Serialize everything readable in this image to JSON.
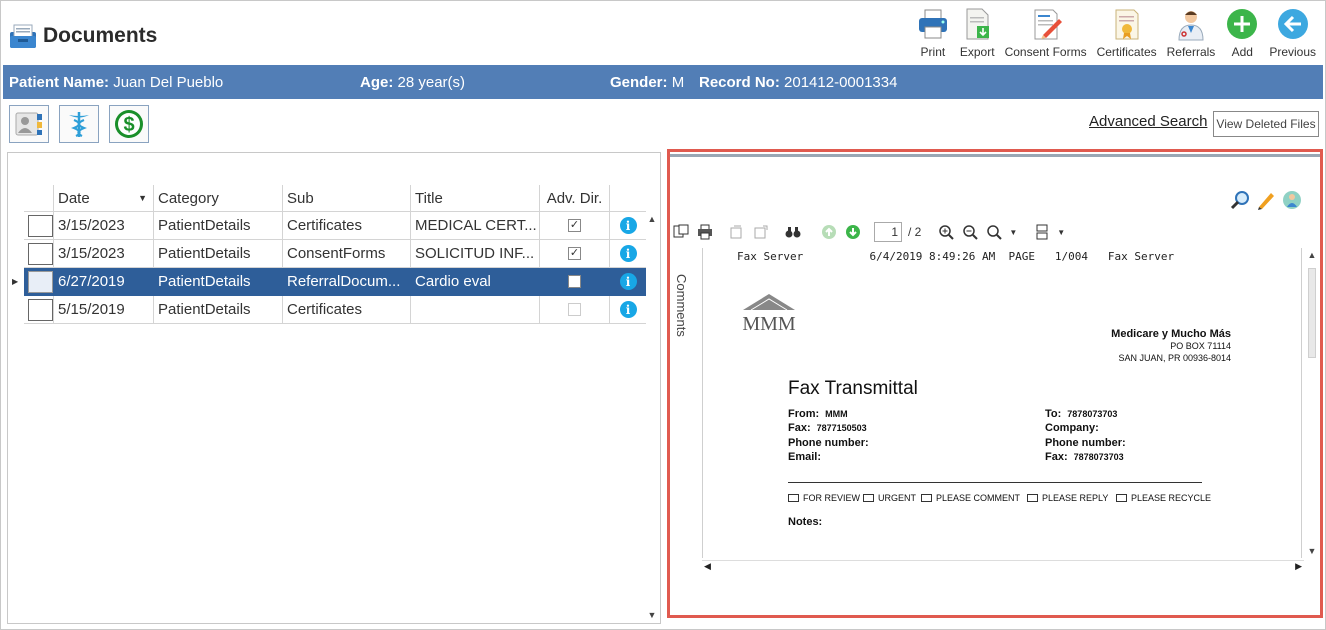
{
  "app": {
    "title": "Documents"
  },
  "toolbar": {
    "print": "Print",
    "export": "Export",
    "consent_forms": "Consent Forms",
    "certificates": "Certificates",
    "referrals": "Referrals",
    "add": "Add",
    "previous": "Previous"
  },
  "patient": {
    "name_label": "Patient Name:",
    "name": "Juan Del Pueblo",
    "age_label": "Age:",
    "age": "28 year(s)",
    "gender_label": "Gender:",
    "gender": "M",
    "record_label": "Record No:",
    "record": "201412-0001334"
  },
  "links": {
    "advanced_search": "Advanced Search",
    "view_deleted": "View Deleted Files"
  },
  "grid": {
    "columns": [
      "Date",
      "Category",
      "Sub",
      "Title",
      "Adv. Dir."
    ],
    "rows": [
      {
        "date": "3/15/2023",
        "category": "PatientDetails",
        "sub": "Certificates",
        "title": "MEDICAL CERT...",
        "adv": "✓"
      },
      {
        "date": "3/15/2023",
        "category": "PatientDetails",
        "sub": "ConsentForms",
        "title": "SOLICITUD INF...",
        "adv": "✓"
      },
      {
        "date": "6/27/2019",
        "category": "PatientDetails",
        "sub": "ReferralDocum...",
        "title": "Cardio eval",
        "adv": ""
      },
      {
        "date": "5/15/2019",
        "category": "PatientDetails",
        "sub": "Certificates",
        "title": "",
        "adv": ""
      }
    ],
    "info": "i"
  },
  "viewer": {
    "page_current": "1",
    "page_total": "/ 2",
    "comments": "Comments"
  },
  "fax": {
    "header": "Fax Server          6/4/2019 8:49:26 AM  PAGE   1/004   Fax Server",
    "logo_text": "MMM",
    "company_name": "Medicare y Mucho Más",
    "company_box": "PO BOX 71114",
    "company_city": "SAN JUAN, PR 00936-8014",
    "title": "Fax Transmittal",
    "from_label": "From:",
    "from": "MMM",
    "fax_label": "Fax:",
    "fax": "7877150503",
    "phone_label": "Phone number:",
    "email_label": "Email:",
    "to_label": "To:",
    "to": "7878073703",
    "company_label": "Company:",
    "to_phone_label": "Phone number:",
    "to_fax_label": "Fax:",
    "to_fax": "7878073703",
    "checks": [
      "FOR REVIEW",
      "URGENT",
      "PLEASE COMMENT",
      "PLEASE REPLY",
      "PLEASE RECYCLE"
    ],
    "notes_label": "Notes:"
  },
  "colors": {
    "patient_bar": "#527eb6",
    "selected_row": "#2e5e99",
    "preview_border": "#e05a4f",
    "add_green": "#3cb54a",
    "previous_blue": "#3da8e0",
    "info_blue": "#18a7e6"
  }
}
